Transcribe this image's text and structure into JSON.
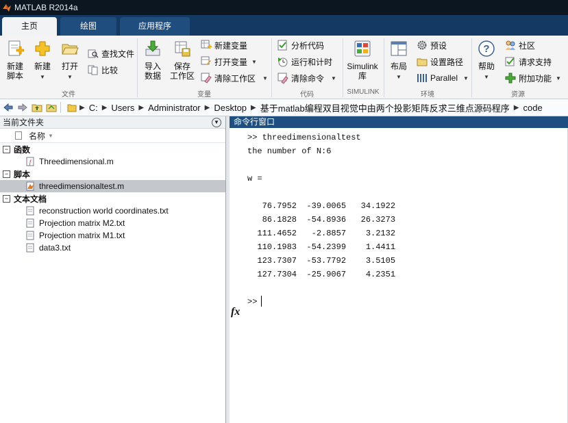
{
  "window": {
    "title": "MATLAB R2014a"
  },
  "tabs": [
    {
      "label": "主页",
      "active": true
    },
    {
      "label": "绘图",
      "active": false
    },
    {
      "label": "应用程序",
      "active": false
    }
  ],
  "ribbon": {
    "file_group": {
      "new_script": "新建\n脚本",
      "new": "新建",
      "open": "打开",
      "find_files": "查找文件",
      "compare": "比较",
      "label": "文件"
    },
    "variable_group": {
      "import_data": "导入\n数据",
      "save_workspace": "保存\n工作区",
      "new_variable": "新建变量",
      "open_variable": "打开变量",
      "clear_workspace": "清除工作区",
      "label": "变量"
    },
    "code_group": {
      "analyze_code": "分析代码",
      "run_and_time": "运行和计时",
      "clear_commands": "清除命令",
      "label": "代码"
    },
    "simulink_group": {
      "simulink_library": "Simulink\n库",
      "label": "SIMULINK"
    },
    "environment_group": {
      "layout": "布局",
      "preferences": "预设",
      "set_path": "设置路径",
      "parallel": "Parallel",
      "label": "环境"
    },
    "resources_group": {
      "help": "帮助",
      "community": "社区",
      "request_support": "请求支持",
      "add_ons": "附加功能",
      "label": "资源"
    }
  },
  "address_bar": {
    "crumbs": [
      "C:",
      "Users",
      "Administrator",
      "Desktop",
      "基于matlab编程双目视觉中由两个投影矩阵反求三维点源码程序",
      "code"
    ]
  },
  "current_folder": {
    "title": "当前文件夹",
    "column_name": "名称",
    "sections": [
      {
        "label": "函数",
        "files": [
          {
            "name": "Threedimensional.m",
            "selected": false
          }
        ]
      },
      {
        "label": "脚本",
        "files": [
          {
            "name": "threedimensionaltest.m",
            "selected": true
          }
        ]
      },
      {
        "label": "文本文档",
        "files": [
          {
            "name": "reconstruction world coordinates.txt",
            "selected": false
          },
          {
            "name": "Projection matrix M2.txt",
            "selected": false
          },
          {
            "name": "Projection matrix M1.txt",
            "selected": false
          },
          {
            "name": "data3.txt",
            "selected": false
          }
        ]
      }
    ]
  },
  "command_window": {
    "title": "命令行窗口",
    "lines": [
      ">> threedimensionaltest",
      "the number of N:6",
      "",
      "w =",
      "",
      "",
      "   76.7952  -39.0065   34.1922",
      "   86.1828  -54.8936   26.3273",
      "  111.4652   -2.8857    3.2132",
      "  110.1983  -54.2399    1.4411",
      "  123.7307  -53.7792    3.5105",
      "  127.7304  -25.9067    4.2351"
    ],
    "prompt": ">>",
    "fx_label": "fx"
  },
  "colors": {
    "titlebar": "#0c1620",
    "tabstrip": "#143a63",
    "cmd_header": "#1e4f80",
    "selected_row": "#c4c7cb"
  }
}
